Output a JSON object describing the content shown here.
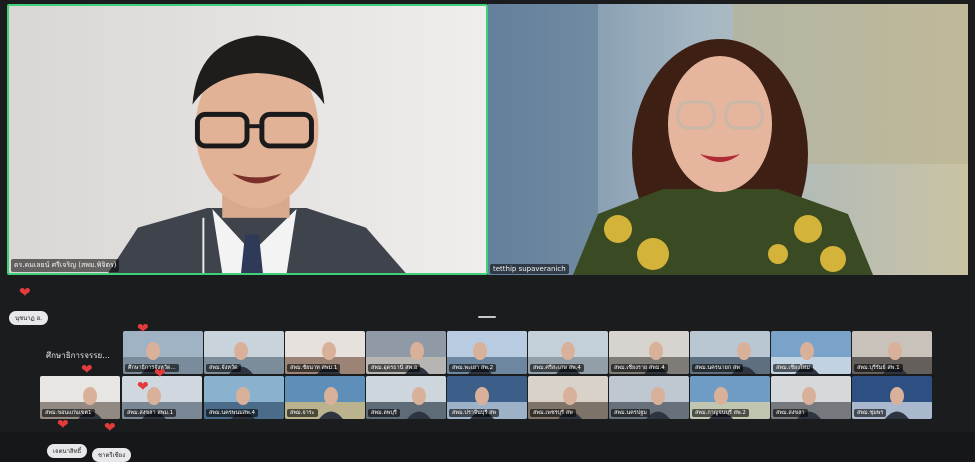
{
  "speakers": {
    "left_name": "ดร.คมเลยน์ ศรีเจริญ (สพม.พิจิตร)",
    "right_name": "tetthip supaveranich"
  },
  "chips": {
    "top_left": "นุชนาฏ อ.",
    "bottom_a": "เจตนาสิทธิ์",
    "bottom_b": "ชาตรีเชียง"
  },
  "strip": {
    "label": "ศึกษาธิการจรรย..."
  },
  "tiles": [
    {
      "label": "ศึกษาธิการจังหวัด..."
    },
    {
      "label": "สพม.จังหวัด"
    },
    {
      "label": "สพม.ชัยนาท สพม.1"
    },
    {
      "label": "สพม.อุดรธานี สพ.อ"
    },
    {
      "label": "สพม.พะเยา สพ.2"
    },
    {
      "label": "สพม.ศรีสะเกษ สพ.4"
    },
    {
      "label": "สพม.เชียงราย สพม.4"
    },
    {
      "label": "สพม.นครนายก สพ"
    },
    {
      "label": "สพม.เชียงใหม่"
    },
    {
      "label": "สพม.บุรีรัมย์ สพ.1"
    },
    {
      "label": "สพม.ขอนแก่นเขต1"
    },
    {
      "label": "สพม.สงขลา สพม.1"
    },
    {
      "label": "สพม.นครพนมสพ.4"
    },
    {
      "label": "สพม.จาระ"
    },
    {
      "label": "สพม.ลพบุรี"
    },
    {
      "label": "สพม.ปราจีนบุรี สพ"
    },
    {
      "label": "สพม.เพชรบุรี สพ"
    },
    {
      "label": "สพม.นครปฐม"
    },
    {
      "label": "สพม.กาญจนบุรี สพ.2"
    },
    {
      "label": "สพม.สงขลา"
    },
    {
      "label": "สพม.ชุมพร"
    },
    {
      "label": "สพม.นราธิวาส"
    },
    {
      "label": "สพม.ตรัง สพ"
    },
    {
      "label": "สพม.สุราษฎร์"
    }
  ]
}
